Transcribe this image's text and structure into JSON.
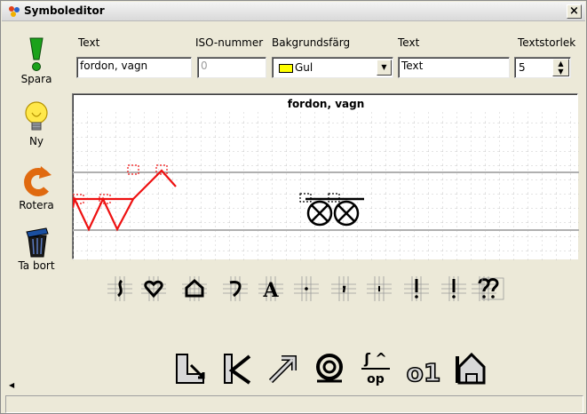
{
  "window": {
    "title": "Symboleditor",
    "close_label": "×"
  },
  "sidebar": {
    "items": [
      {
        "label": "Spara",
        "icon": "exclamation-icon"
      },
      {
        "label": "Ny",
        "icon": "lightbulb-icon"
      },
      {
        "label": "Rotera",
        "icon": "rotate-icon"
      },
      {
        "label": "Ta bort",
        "icon": "trash-icon"
      }
    ]
  },
  "fields": {
    "text_label": "Text",
    "text_value": "fordon, vagn",
    "iso_label": "ISO-nummer",
    "iso_value": "0",
    "bg_label": "Bakgrundsfärg",
    "bg_value": "Gul",
    "bg_color": "#ffff00",
    "text2_label": "Text",
    "text2_value": "Text",
    "size_label": "Textstorlek",
    "size_value": "5"
  },
  "canvas": {
    "title": "fordon, vagn"
  },
  "palette": [
    {
      "icon": "wave-grid-icon"
    },
    {
      "icon": "heart-grid-icon"
    },
    {
      "icon": "house-grid-icon"
    },
    {
      "icon": "hook-grid-icon"
    },
    {
      "icon": "letter-a-grid-icon"
    },
    {
      "icon": "dot-grid-icon"
    },
    {
      "icon": "comma-grid-icon"
    },
    {
      "icon": "tick-grid-icon"
    },
    {
      "icon": "exclamation-grid-icon"
    },
    {
      "icon": "bracket-grid-icon"
    },
    {
      "icon": "question-grid-icon"
    },
    {
      "icon": "question-box-grid-icon"
    }
  ],
  "tools": [
    {
      "icon": "move-down-icon"
    },
    {
      "icon": "arrow-upleft-icon"
    },
    {
      "icon": "arrow-upright-icon"
    },
    {
      "icon": "spiral-icon"
    },
    {
      "icon": "flip-icon",
      "text_top": "ʃ ^",
      "text_bottom": "op"
    },
    {
      "icon": "o1-icon",
      "text": "o1"
    },
    {
      "icon": "house-outline-icon"
    }
  ],
  "statusbar": {
    "text": ""
  }
}
